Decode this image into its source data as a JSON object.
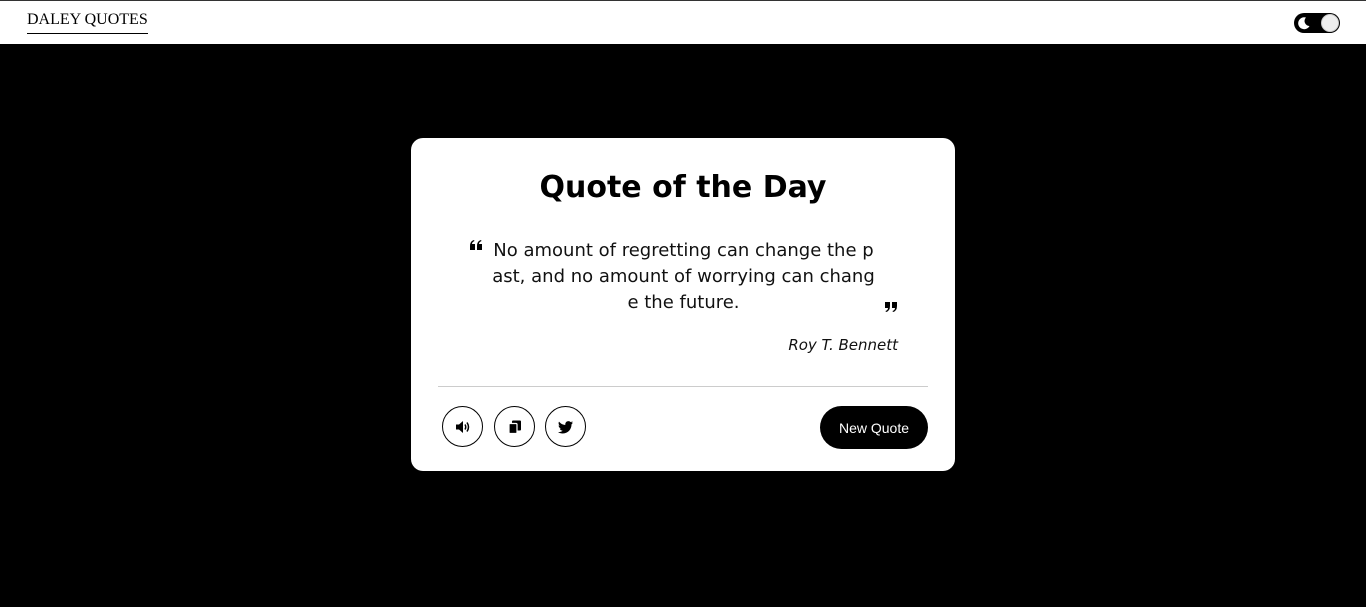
{
  "navbar": {
    "brand": "DALEY QUOTES",
    "theme_toggle_icon": "moon-icon"
  },
  "card": {
    "title": "Quote of the Day",
    "quote": "No amount of regretting can change the past, and no amount of worrying can change the future.",
    "author": "Roy T. Bennett",
    "buttons": {
      "speak_icon": "speaker-icon",
      "copy_icon": "copy-icon",
      "tweet_icon": "twitter-icon",
      "new_quote_label": "New Quote"
    }
  },
  "colors": {
    "background": "#000000",
    "card": "#ffffff",
    "accent": "#000000"
  }
}
